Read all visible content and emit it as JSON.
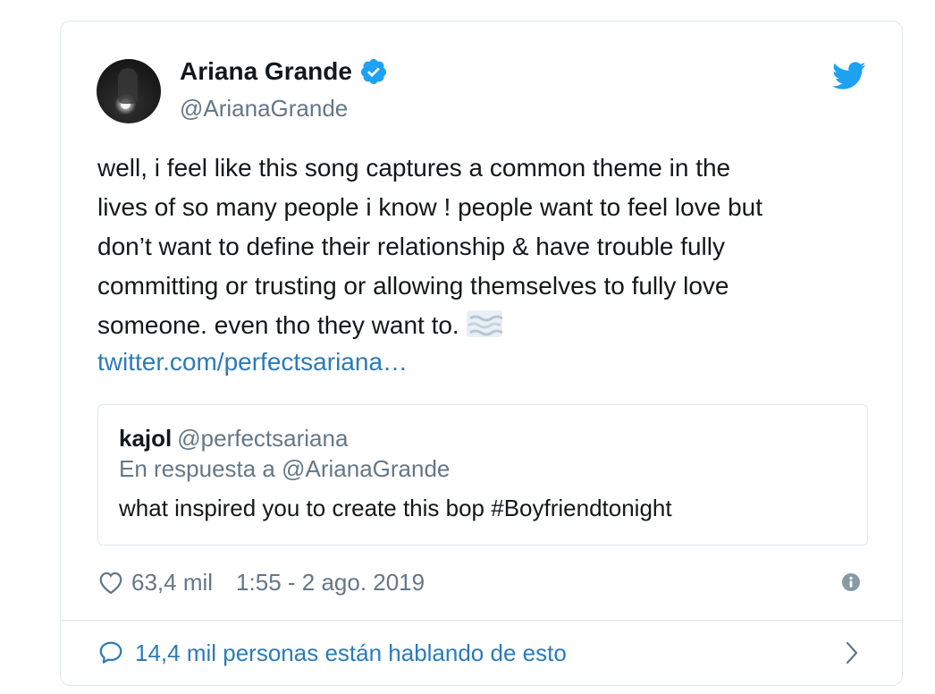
{
  "author": {
    "name": "Ariana Grande",
    "handle": "@ArianaGrande",
    "verified": true
  },
  "tweet": {
    "lines": [
      "well, i feel like this song captures a common theme in the",
      "lives of so many people i know ! people want to feel love but",
      "don’t want to define their relationship & have trouble fully",
      "committing or trusting or allowing themselves to fully love",
      "someone. even tho they want to."
    ],
    "emoji": "fog-emoji",
    "link": "twitter.com/perfectsariana…"
  },
  "quoted": {
    "name": "kajol",
    "handle": "@perfectsariana",
    "reply_to": "En respuesta a @ArianaGrande",
    "text": "what inspired you to create this bop #Boyfriendtonight"
  },
  "meta": {
    "likes": "63,4 mil",
    "timestamp": "1:55 - 2 ago. 2019"
  },
  "footer": {
    "conversation": "14,4 mil personas están hablando de esto"
  },
  "colors": {
    "link": "#2b7bb9",
    "muted": "#657786",
    "twitter_blue": "#1da1f2",
    "border": "#e1e8ed"
  }
}
